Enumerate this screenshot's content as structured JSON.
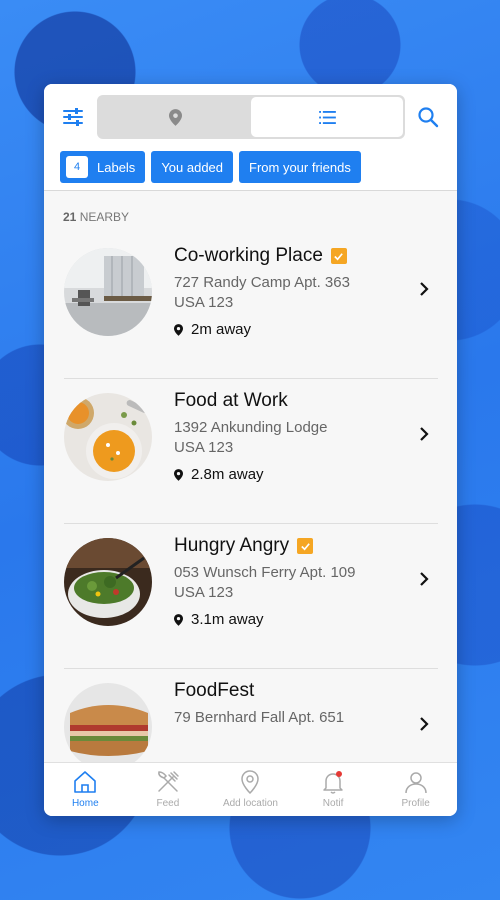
{
  "header": {
    "filter_icon": "sliders-icon",
    "segments": [
      {
        "icon": "map-pin-icon"
      },
      {
        "icon": "list-icon"
      }
    ],
    "search_icon": "search-icon"
  },
  "chips": {
    "labels_count": "4",
    "labels_label": "Labels",
    "you_added_label": "You added",
    "from_friends_label": "From your friends"
  },
  "nearby": {
    "count": "21",
    "label": "NEARBY"
  },
  "places": [
    {
      "name": "Co-working Place",
      "verified": true,
      "address_line1": "727 Randy Camp Apt. 363",
      "address_line2": "USA 123",
      "distance": "2m away"
    },
    {
      "name": "Food at Work",
      "verified": false,
      "address_line1": "1392 Ankunding Lodge",
      "address_line2": "USA 123",
      "distance": "2.8m away"
    },
    {
      "name": "Hungry Angry",
      "verified": true,
      "address_line1": "053 Wunsch Ferry Apt. 109",
      "address_line2": "USA 123",
      "distance": "3.1m away"
    },
    {
      "name": "FoodFest",
      "verified": false,
      "address_line1": "79 Bernhard Fall Apt. 651",
      "address_line2": "",
      "distance": ""
    }
  ],
  "tabs": [
    {
      "label": "Home",
      "icon": "home-icon",
      "active": true
    },
    {
      "label": "Feed",
      "icon": "fork-knife-icon",
      "active": false
    },
    {
      "label": "Add location",
      "icon": "location-pin-icon",
      "active": false
    },
    {
      "label": "Notif",
      "icon": "bell-icon",
      "active": false
    },
    {
      "label": "Profile",
      "icon": "user-icon",
      "active": false
    }
  ],
  "colors": {
    "accent": "#1f7ff0",
    "verified": "#f5a623",
    "notif_dot": "#e53935",
    "background": "#2f80f0"
  }
}
